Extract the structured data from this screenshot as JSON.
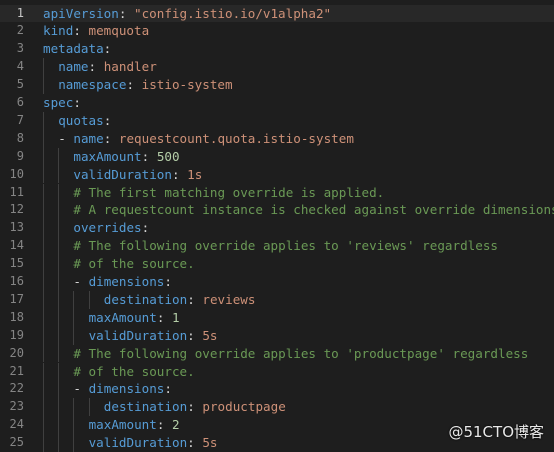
{
  "editor": {
    "lines": [
      {
        "num": "1",
        "indent": 0,
        "parts": [
          {
            "t": "apiVersion",
            "c": "k"
          },
          {
            "t": ": ",
            "c": "p"
          },
          {
            "t": "\"config.istio.io/v1alpha2\"",
            "c": "s"
          }
        ]
      },
      {
        "num": "2",
        "indent": 0,
        "parts": [
          {
            "t": "kind",
            "c": "k"
          },
          {
            "t": ": ",
            "c": "p"
          },
          {
            "t": "memquota",
            "c": "s"
          }
        ]
      },
      {
        "num": "3",
        "indent": 0,
        "parts": [
          {
            "t": "metadata",
            "c": "k"
          },
          {
            "t": ":",
            "c": "p"
          }
        ]
      },
      {
        "num": "4",
        "indent": 2,
        "parts": [
          {
            "t": "name",
            "c": "k"
          },
          {
            "t": ": ",
            "c": "p"
          },
          {
            "t": "handler",
            "c": "s"
          }
        ]
      },
      {
        "num": "5",
        "indent": 2,
        "parts": [
          {
            "t": "namespace",
            "c": "k"
          },
          {
            "t": ": ",
            "c": "p"
          },
          {
            "t": "istio-system",
            "c": "s"
          }
        ]
      },
      {
        "num": "6",
        "indent": 0,
        "parts": [
          {
            "t": "spec",
            "c": "k"
          },
          {
            "t": ":",
            "c": "p"
          }
        ]
      },
      {
        "num": "7",
        "indent": 2,
        "parts": [
          {
            "t": "quotas",
            "c": "k"
          },
          {
            "t": ":",
            "c": "p"
          }
        ]
      },
      {
        "num": "8",
        "indent": 2,
        "parts": [
          {
            "t": "- ",
            "c": "p"
          },
          {
            "t": "name",
            "c": "k"
          },
          {
            "t": ": ",
            "c": "p"
          },
          {
            "t": "requestcount.quota.istio-system",
            "c": "s"
          }
        ]
      },
      {
        "num": "9",
        "indent": 4,
        "parts": [
          {
            "t": "maxAmount",
            "c": "k"
          },
          {
            "t": ": ",
            "c": "p"
          },
          {
            "t": "500",
            "c": "n"
          }
        ]
      },
      {
        "num": "10",
        "indent": 4,
        "parts": [
          {
            "t": "validDuration",
            "c": "k"
          },
          {
            "t": ": ",
            "c": "p"
          },
          {
            "t": "1s",
            "c": "s"
          }
        ]
      },
      {
        "num": "11",
        "indent": 4,
        "parts": [
          {
            "t": "# The first matching override is applied.",
            "c": "c"
          }
        ]
      },
      {
        "num": "12",
        "indent": 4,
        "parts": [
          {
            "t": "# A requestcount instance is checked against override dimensions.",
            "c": "c"
          }
        ]
      },
      {
        "num": "13",
        "indent": 4,
        "parts": [
          {
            "t": "overrides",
            "c": "k"
          },
          {
            "t": ":",
            "c": "p"
          }
        ]
      },
      {
        "num": "14",
        "indent": 4,
        "parts": [
          {
            "t": "# The following override applies to 'reviews' regardless",
            "c": "c"
          }
        ]
      },
      {
        "num": "15",
        "indent": 4,
        "parts": [
          {
            "t": "# of the source.",
            "c": "c"
          }
        ]
      },
      {
        "num": "16",
        "indent": 4,
        "parts": [
          {
            "t": "- ",
            "c": "p"
          },
          {
            "t": "dimensions",
            "c": "k"
          },
          {
            "t": ":",
            "c": "p"
          }
        ]
      },
      {
        "num": "17",
        "indent": 8,
        "parts": [
          {
            "t": "destination",
            "c": "k"
          },
          {
            "t": ": ",
            "c": "p"
          },
          {
            "t": "reviews",
            "c": "s"
          }
        ]
      },
      {
        "num": "18",
        "indent": 6,
        "parts": [
          {
            "t": "maxAmount",
            "c": "k"
          },
          {
            "t": ": ",
            "c": "p"
          },
          {
            "t": "1",
            "c": "n"
          }
        ]
      },
      {
        "num": "19",
        "indent": 6,
        "parts": [
          {
            "t": "validDuration",
            "c": "k"
          },
          {
            "t": ": ",
            "c": "p"
          },
          {
            "t": "5s",
            "c": "s"
          }
        ]
      },
      {
        "num": "20",
        "indent": 4,
        "parts": [
          {
            "t": "# The following override applies to 'productpage' regardless",
            "c": "c"
          }
        ]
      },
      {
        "num": "21",
        "indent": 4,
        "parts": [
          {
            "t": "# of the source.",
            "c": "c"
          }
        ]
      },
      {
        "num": "22",
        "indent": 4,
        "parts": [
          {
            "t": "- ",
            "c": "p"
          },
          {
            "t": "dimensions",
            "c": "k"
          },
          {
            "t": ":",
            "c": "p"
          }
        ]
      },
      {
        "num": "23",
        "indent": 8,
        "parts": [
          {
            "t": "destination",
            "c": "k"
          },
          {
            "t": ": ",
            "c": "p"
          },
          {
            "t": "productpage",
            "c": "s"
          }
        ]
      },
      {
        "num": "24",
        "indent": 6,
        "parts": [
          {
            "t": "maxAmount",
            "c": "k"
          },
          {
            "t": ": ",
            "c": "p"
          },
          {
            "t": "2",
            "c": "n"
          }
        ]
      },
      {
        "num": "25",
        "indent": 6,
        "parts": [
          {
            "t": "validDuration",
            "c": "k"
          },
          {
            "t": ": ",
            "c": "p"
          },
          {
            "t": "5s",
            "c": "s"
          }
        ]
      }
    ],
    "current_line": "1"
  },
  "watermark": "@51CTO博客",
  "colors": {
    "background": "#1e1e1e",
    "key": "#569cd6",
    "string": "#ce9178",
    "number": "#b5cea8",
    "comment": "#6a9955",
    "punctuation": "#d4d4d4",
    "line_number": "#858585"
  }
}
